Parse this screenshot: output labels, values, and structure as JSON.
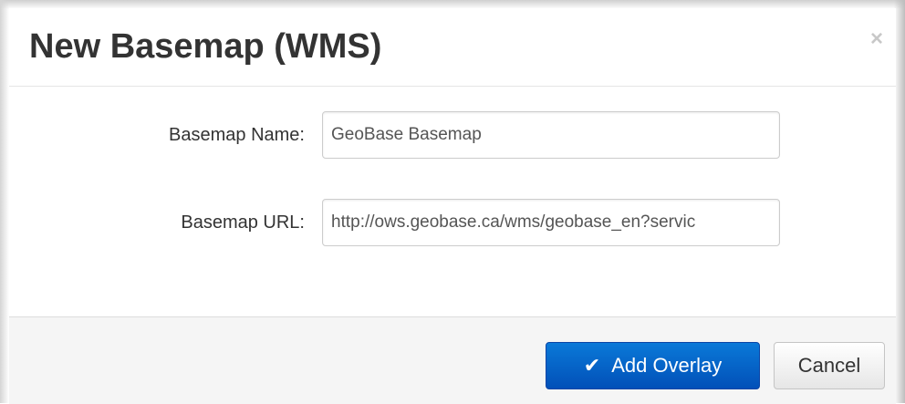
{
  "modal": {
    "title": "New Basemap (WMS)",
    "close_glyph": "×"
  },
  "form": {
    "name_label": "Basemap Name:",
    "name_value": "GeoBase Basemap",
    "url_label": "Basemap URL:",
    "url_value": "http://ows.geobase.ca/wms/geobase_en?servic"
  },
  "footer": {
    "add_icon": "check-icon",
    "add_glyph": "✔",
    "add_label": "Add Overlay",
    "cancel_label": "Cancel"
  },
  "colors": {
    "primary": "#0250b8",
    "footer_bg": "#f5f5f5",
    "title_text": "#333333"
  }
}
